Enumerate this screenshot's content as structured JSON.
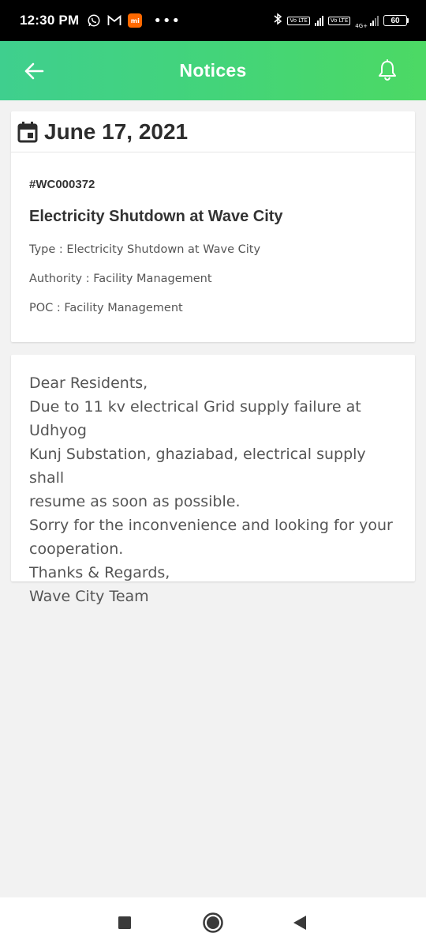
{
  "status_bar": {
    "time": "12:30 PM",
    "mi_label": "mi",
    "dots": "•••",
    "lte1": "Vo LTE",
    "lte2": "Vo LTE",
    "network": "4G+",
    "battery": "60"
  },
  "header": {
    "title": "Notices",
    "back_icon": "arrow-left-icon",
    "bell_icon": "bell-icon",
    "background_from": "#3fcf8e",
    "background_to": "#4cd964"
  },
  "notice": {
    "date": "June 17, 2021",
    "date_icon": "calendar-icon",
    "id": "#WC000372",
    "title": "Electricity Shutdown at Wave City",
    "type": "Type : Electricity Shutdown at Wave City",
    "authority": "Authority : Facility Management",
    "poc": "POC : Facility Management"
  },
  "message": {
    "lines": [
      "Dear Residents,",
      "Due to 11 kv electrical Grid supply failure at Udhyog",
      "Kunj Substation, ghaziabad, electrical supply shall",
      "resume as soon as possible.",
      "Sorry for the inconvenience and looking for your",
      "cooperation.",
      "Thanks & Regards,",
      "Wave City Team"
    ]
  },
  "nav_bar": {
    "recent_icon": "square-icon",
    "home_icon": "circle-icon",
    "back_icon": "triangle-back-icon"
  }
}
